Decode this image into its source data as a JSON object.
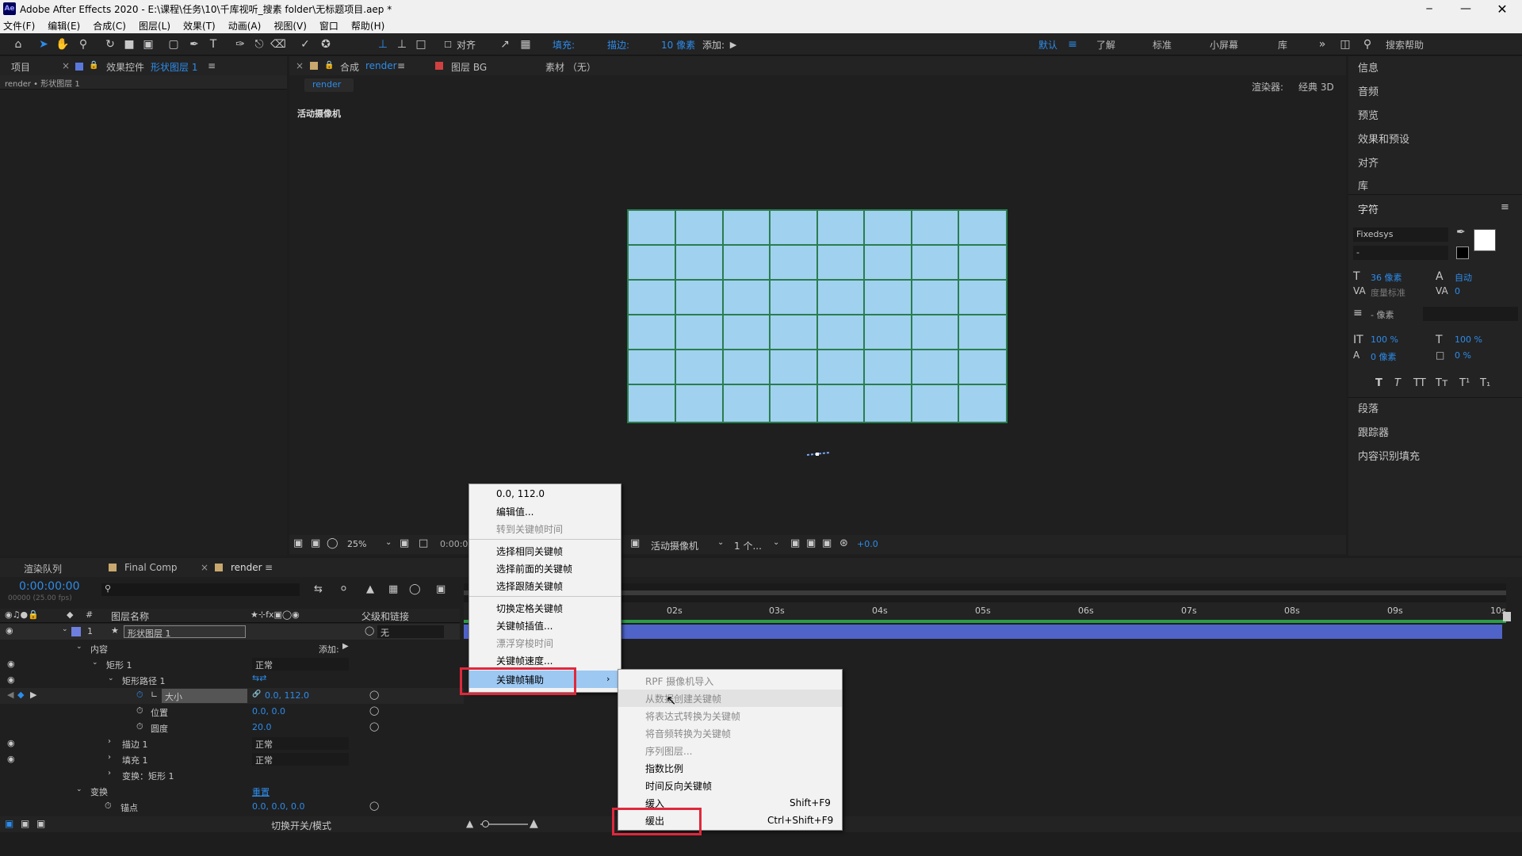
{
  "titlebar": {
    "app_badge": "Ae",
    "title": "Adobe After Effects 2020 - E:\\课程\\任务\\10\\千库视听_搜素 folder\\无标题项目.aep *"
  },
  "menubar": [
    "文件(F)",
    "编辑(E)",
    "合成(C)",
    "图层(L)",
    "效果(T)",
    "动画(A)",
    "视图(V)",
    "窗口",
    "帮助(H)"
  ],
  "toolbar": {
    "align_label": "对齐",
    "fill_label": "填充:",
    "stroke_label": "描边:",
    "stroke_width": "10 像素",
    "add_label": "添加:",
    "workspaces": [
      "默认",
      "了解",
      "标准",
      "小屏幕",
      "库"
    ],
    "search_help": "搜索帮助",
    "accent": "#2d8ceb",
    "fill_color": "#1e9bff"
  },
  "left_panel": {
    "tab_project": "项目",
    "tab_effects_prefix": "效果控件",
    "tab_effects_layer": "形状图层 1",
    "breadcrumb": "render • 形状图层 1"
  },
  "comp_panel": {
    "tab_prefix": "合成",
    "tab_comp_name": "render",
    "tab_layer": "图层 BG",
    "tab_footage": "素材 （无）",
    "sub_tab": "render",
    "renderer_label": "渲染器:",
    "renderer_value": "经典 3D",
    "camera_label": "活动摄像机",
    "zoom": "25%",
    "time": "0:00:00",
    "camera_dropdown": "活动摄像机",
    "views": "1 个...",
    "exposure": "+0.0"
  },
  "right_panel": {
    "items_top": [
      "信息",
      "音频",
      "预览",
      "效果和预设",
      "对齐",
      "库"
    ],
    "character_title": "字符",
    "font": "Fixedsys",
    "font_style": "-",
    "font_size": "36 像素",
    "leading": "自动",
    "kerning": "度量标准",
    "tracking": "0",
    "stroke": "- 像素",
    "v_scale": "100 %",
    "h_scale": "100 %",
    "baseline": "0 像素",
    "tsume": "0 %",
    "style_buttons": [
      "T",
      "T",
      "TT",
      "Tт",
      "T¹",
      "T₁"
    ],
    "items_bottom": [
      "段落",
      "跟踪器",
      "内容识别填充"
    ]
  },
  "timeline": {
    "tab_render_queue": "渲染队列",
    "tab_final": "Final Comp",
    "tab_render": "render",
    "timecode": "0:00:00:00",
    "fps": "00000 (25.00 fps)",
    "col_layer_name": "图层名称",
    "col_parent": "父级和链接",
    "layer_num": "1",
    "layer_name": "形状图层 1",
    "parent_value": "无",
    "rows": [
      {
        "name": "内容",
        "value": "添加:"
      },
      {
        "name": "矩形 1",
        "value": "正常"
      },
      {
        "name": "矩形路径 1",
        "value": ""
      },
      {
        "name": "大小",
        "value": "0.0, 112.0"
      },
      {
        "name": "位置",
        "value": "0.0, 0.0"
      },
      {
        "name": "圆度",
        "value": "20.0"
      },
      {
        "name": "描边 1",
        "value": "正常"
      },
      {
        "name": "填充 1",
        "value": "正常"
      },
      {
        "name": "变换：矩形 1",
        "value": ""
      },
      {
        "name": "变换",
        "value": "重置"
      },
      {
        "name": "锚点",
        "value": "0.0, 0.0, 0.0"
      }
    ],
    "ruler": [
      "02s",
      "03s",
      "04s",
      "05s",
      "06s",
      "07s",
      "08s",
      "09s",
      "10s"
    ],
    "footer_toggle": "切换开关/模式"
  },
  "context_menu": {
    "items": [
      {
        "label": "0.0, 112.0",
        "disabled": false
      },
      {
        "label": "编辑值...",
        "disabled": false
      },
      {
        "label": "转到关键帧时间",
        "disabled": true
      },
      {
        "label": "选择相同关键帧",
        "disabled": false
      },
      {
        "label": "选择前面的关键帧",
        "disabled": false
      },
      {
        "label": "选择跟随关键帧",
        "disabled": false
      },
      {
        "label": "切换定格关键帧",
        "disabled": false
      },
      {
        "label": "关键帧插值...",
        "disabled": false
      },
      {
        "label": "漂浮穿梭时间",
        "disabled": true
      },
      {
        "label": "关键帧速度...",
        "disabled": false
      },
      {
        "label": "关键帧辅助",
        "disabled": false
      }
    ]
  },
  "submenu": {
    "items": [
      {
        "label": "RPF 摄像机导入",
        "shortcut": "",
        "disabled": true
      },
      {
        "label": "从数据创建关键帧",
        "shortcut": "",
        "disabled": true
      },
      {
        "label": "将表达式转换为关键帧",
        "shortcut": "",
        "disabled": true
      },
      {
        "label": "将音频转换为关键帧",
        "shortcut": "",
        "disabled": true
      },
      {
        "label": "序列图层...",
        "shortcut": "",
        "disabled": true
      },
      {
        "label": "指数比例",
        "shortcut": "",
        "disabled": false
      },
      {
        "label": "时间反向关键帧",
        "shortcut": "",
        "disabled": false
      },
      {
        "label": "缓入",
        "shortcut": "Shift+F9",
        "disabled": false
      },
      {
        "label": "缓出",
        "shortcut": "Ctrl+Shift+F9",
        "disabled": false
      }
    ]
  }
}
